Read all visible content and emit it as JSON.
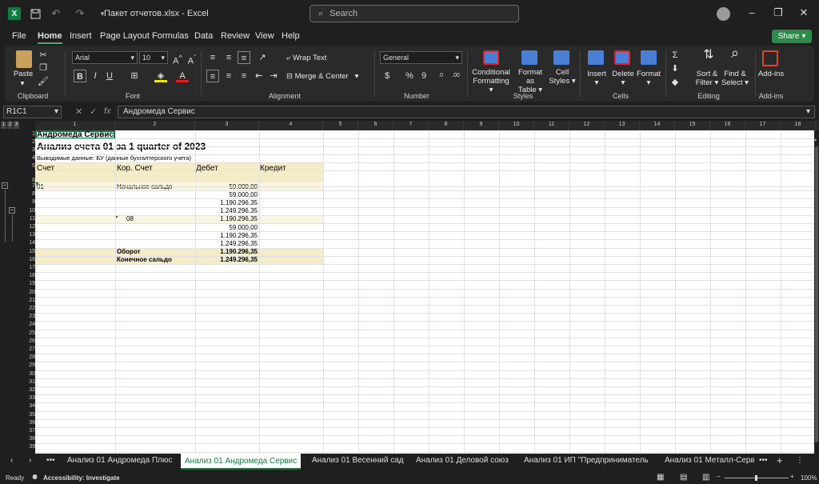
{
  "titlebar": {
    "title": "Пакет отчетов.xlsx  -  Excel",
    "search_placeholder": "Search"
  },
  "menu": {
    "items": [
      "File",
      "Home",
      "Insert",
      "Page Layout",
      "Formulas",
      "Data",
      "Review",
      "View",
      "Help"
    ],
    "share": "Share"
  },
  "ribbon": {
    "clipboard": {
      "label": "Clipboard",
      "paste": "Paste"
    },
    "font": {
      "label": "Font",
      "name": "Arial",
      "size": "10"
    },
    "alignment": {
      "label": "Alignment",
      "wrap": "Wrap Text",
      "merge": "Merge & Center"
    },
    "number": {
      "label": "Number",
      "format": "General"
    },
    "styles": {
      "label": "Styles",
      "cond1": "Conditional",
      "cond2": "Formatting",
      "fmt1": "Format as",
      "fmt2": "Table",
      "cell1": "Cell",
      "cell2": "Styles"
    },
    "cells": {
      "label": "Cells",
      "insert": "Insert",
      "delete": "Delete",
      "format": "Format"
    },
    "editing": {
      "label": "Editing",
      "sort1": "Sort &",
      "sort2": "Filter",
      "find1": "Find &",
      "find2": "Select"
    },
    "addins": {
      "label": "Add-ins",
      "btn": "Add-ins"
    }
  },
  "formula": {
    "namebox": "R1C1",
    "value": "Андромеда Сервис"
  },
  "columns": [
    "1",
    "2",
    "3",
    "4",
    "5",
    "6",
    "7",
    "8",
    "9",
    "10",
    "11",
    "12",
    "13",
    "14",
    "15",
    "16",
    "17",
    "18"
  ],
  "outline_levels": [
    "1",
    "2",
    "3"
  ],
  "cells": {
    "r1": "Андромеда Сервис",
    "r2": "Анализ счета 01 за 1 quarter of 2023",
    "r4": "Выводимые данные: БУ (данные бухгалтерского учета)",
    "h_acc": "Счет",
    "h_cor": "Кор. Счет",
    "h_deb": "Дебет",
    "h_cred": "Кредит",
    "r8_acc": "01",
    "r8_cor": "Начальное сальдо",
    "r8_deb": "59.000,00",
    "r9_deb": "59.000,00",
    "r10_deb": "1.190.296,35",
    "r11_deb": "1.249.296,35",
    "r12_cor": "08",
    "r12_deb": "1.190.296,35",
    "r13_deb": "59.000,00",
    "r14_deb": "1.190.296,35",
    "r15_deb": "1.249.296,35",
    "r16_cor": "Оборот",
    "r16_deb": "1.190.296,35",
    "r17_cor": "Конечное сальдо",
    "r17_deb": "1.249.296,35"
  },
  "tabs": [
    "Анализ 01 Андромеда Плюс",
    "Анализ 01 Андромеда Сервис",
    "Анализ 01 Весенний сад",
    "Анализ 01 Деловой союз",
    "Анализ 01 ИП \"Предприниматель",
    "Анализ 01 Металл-Серв"
  ],
  "status": {
    "ready": "Ready",
    "accessibility": "Accessibility: Investigate",
    "zoom": "100%"
  },
  "colors": {
    "accent": "#107c41",
    "header_fill": "#f4ebc7",
    "row_fill": "#fbf6e4"
  }
}
